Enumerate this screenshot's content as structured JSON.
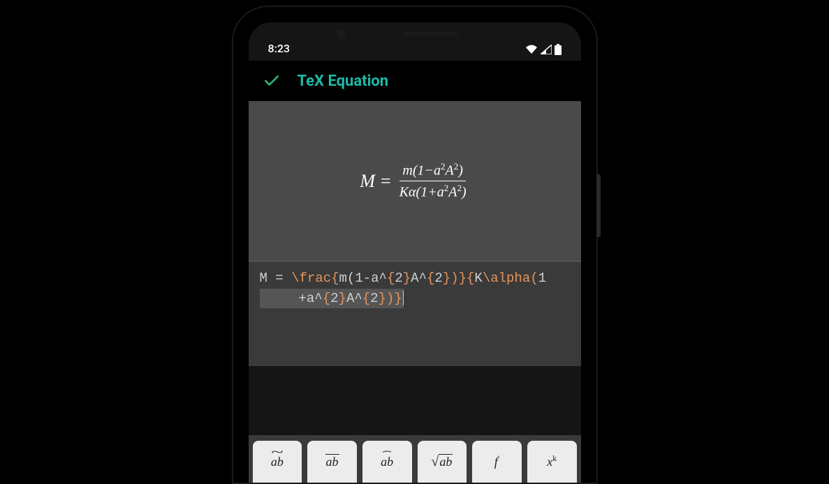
{
  "status_bar": {
    "time": "8:23"
  },
  "app_bar": {
    "title": "TeX Equation"
  },
  "preview": {
    "lhs": "M",
    "eq": "=",
    "numerator_html": "m(1−a<sup>2</sup>A<sup>2</sup>)",
    "denominator_html": "Kα(1+a<sup>2</sup>A<sup>2</sup>)"
  },
  "editor": {
    "raw": "M = \\frac{m(1-a^{2}A^{2})}{K\\alpha(1+a^{2}A^{2})}",
    "line1_tokens": [
      {
        "t": "M = ",
        "c": "plain"
      },
      {
        "t": "\\frac{",
        "c": "cmd"
      },
      {
        "t": "m(1-a^",
        "c": "plain"
      },
      {
        "t": "{",
        "c": "brace"
      },
      {
        "t": "2",
        "c": "plain"
      },
      {
        "t": "}",
        "c": "brace"
      },
      {
        "t": "A^",
        "c": "plain"
      },
      {
        "t": "{",
        "c": "brace"
      },
      {
        "t": "2",
        "c": "plain"
      },
      {
        "t": "})}{",
        "c": "cmd"
      },
      {
        "t": "K",
        "c": "plain"
      },
      {
        "t": "\\alpha(",
        "c": "cmd"
      },
      {
        "t": "1",
        "c": "plain"
      }
    ],
    "line2_tokens": [
      {
        "t": "+a^",
        "c": "plain"
      },
      {
        "t": "{",
        "c": "brace"
      },
      {
        "t": "2",
        "c": "plain"
      },
      {
        "t": "}",
        "c": "brace"
      },
      {
        "t": "A^",
        "c": "plain"
      },
      {
        "t": "{",
        "c": "brace"
      },
      {
        "t": "2",
        "c": "plain"
      },
      {
        "t": "})}",
        "c": "cmd"
      }
    ]
  },
  "toolbar": {
    "keys": [
      {
        "name": "tilde-key",
        "kind": "tilde",
        "label": "ab"
      },
      {
        "name": "overline-key",
        "kind": "overline",
        "label": "ab"
      },
      {
        "name": "widehat-key",
        "kind": "hat",
        "label": "ab"
      },
      {
        "name": "sqrt-key",
        "kind": "sqrt",
        "label": "ab"
      },
      {
        "name": "prime-key",
        "kind": "prime",
        "base": "f",
        "sup": "′"
      },
      {
        "name": "power-key",
        "kind": "power",
        "base": "x",
        "sup": "k"
      }
    ]
  }
}
